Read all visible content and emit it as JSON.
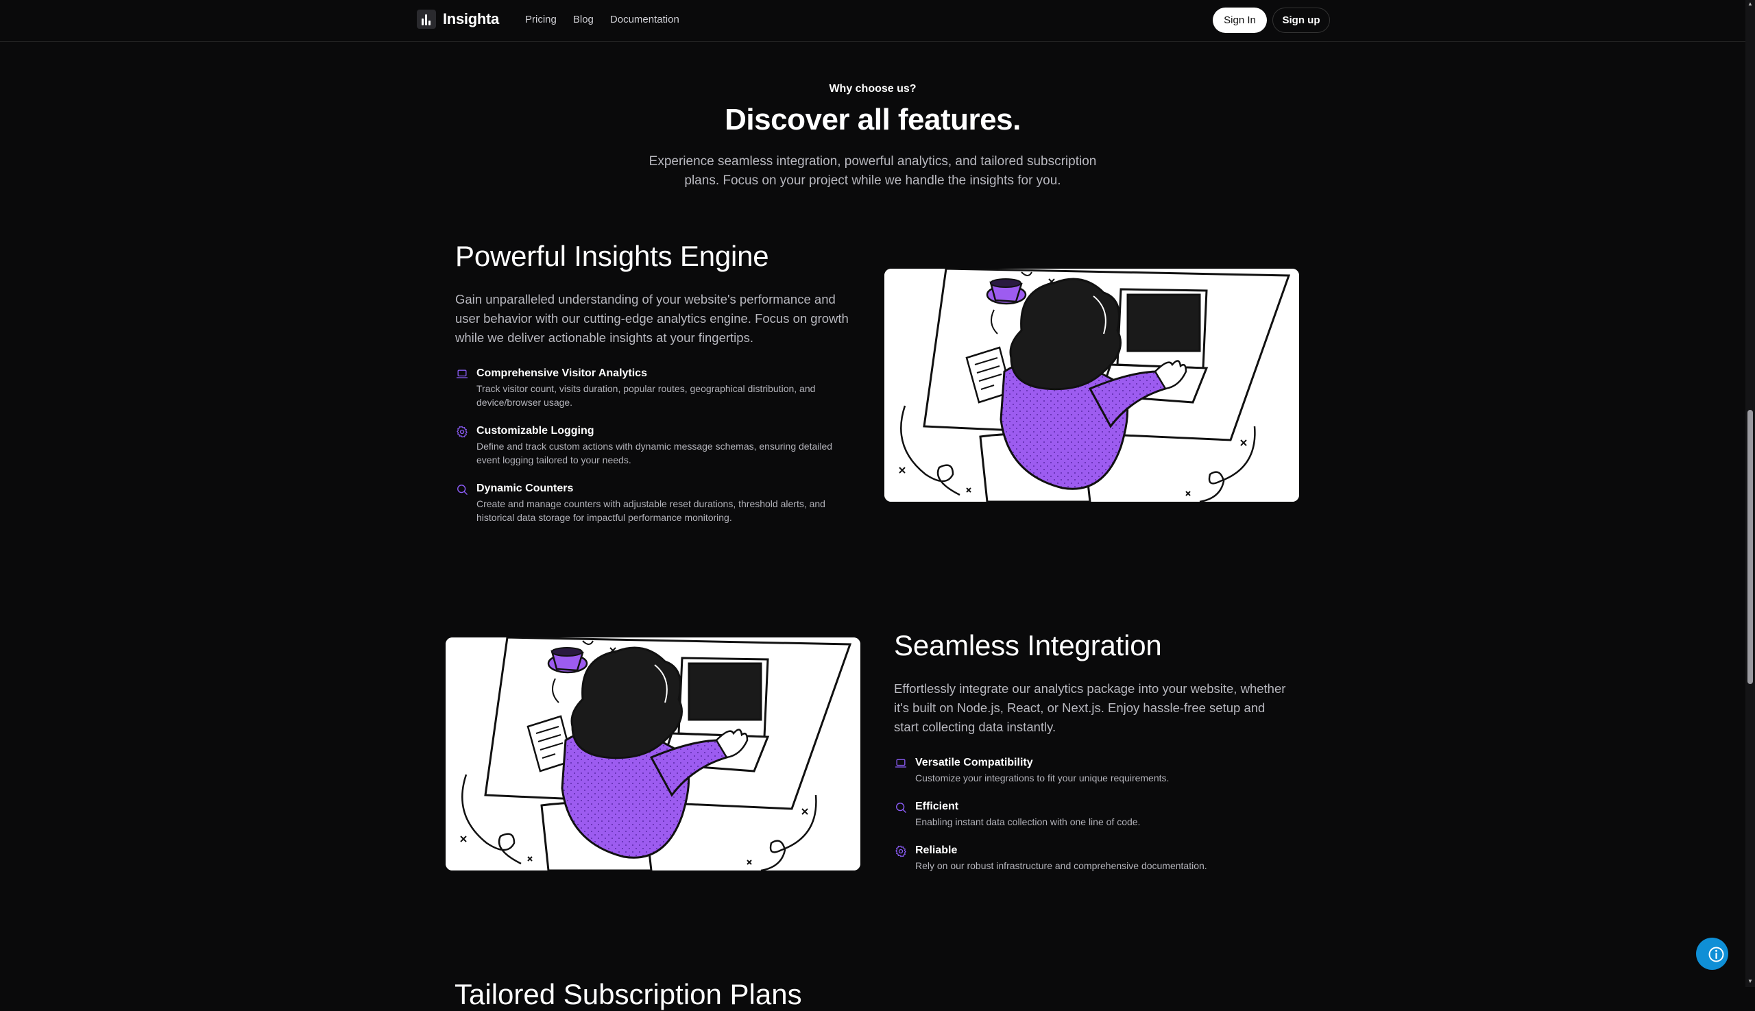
{
  "nav": {
    "brand": "Insighta",
    "links": [
      "Pricing",
      "Blog",
      "Documentation"
    ],
    "sign_in": "Sign In",
    "sign_up": "Sign up"
  },
  "section": {
    "eyebrow": "Why choose us?",
    "headline": "Discover all features.",
    "intro": "Experience seamless integration, powerful analytics, and tailored subscription plans. Focus on your project while we handle the insights for you."
  },
  "features": [
    {
      "title": "Powerful Insights Engine",
      "description": "Gain unparalleled understanding of your website's performance and user behavior with our cutting-edge analytics engine. Focus on growth while we deliver actionable insights at your fingertips.",
      "items": [
        {
          "icon": "laptop-icon",
          "title": "Comprehensive Visitor Analytics",
          "text": "Track visitor count, visits duration, popular routes, geographical distribution, and device/browser usage."
        },
        {
          "icon": "gear-icon",
          "title": "Customizable Logging",
          "text": "Define and track custom actions with dynamic message schemas, ensuring detailed event logging tailored to your needs."
        },
        {
          "icon": "search-icon",
          "title": "Dynamic Counters",
          "text": "Create and manage counters with adjustable reset durations, threshold alerts, and historical data storage for impactful performance monitoring."
        }
      ]
    },
    {
      "title": "Seamless Integration",
      "description": "Effortlessly integrate our analytics package into your website, whether it's built on Node.js, React, or Next.js. Enjoy hassle-free setup and start collecting data instantly.",
      "items": [
        {
          "icon": "laptop-icon",
          "title": "Versatile Compatibility",
          "text": "Customize your integrations to fit your unique requirements."
        },
        {
          "icon": "search-icon",
          "title": "Efficient",
          "text": "Enabling instant data collection with one line of code."
        },
        {
          "icon": "gear-icon",
          "title": "Reliable",
          "text": "Rely on our robust infrastructure and comprehensive documentation."
        }
      ]
    }
  ],
  "next_section_peek": "Tailored Subscription Plans",
  "colors": {
    "accent": "#8b5cf6",
    "background": "#0a0a0b",
    "fab": "#0f8fd6"
  }
}
